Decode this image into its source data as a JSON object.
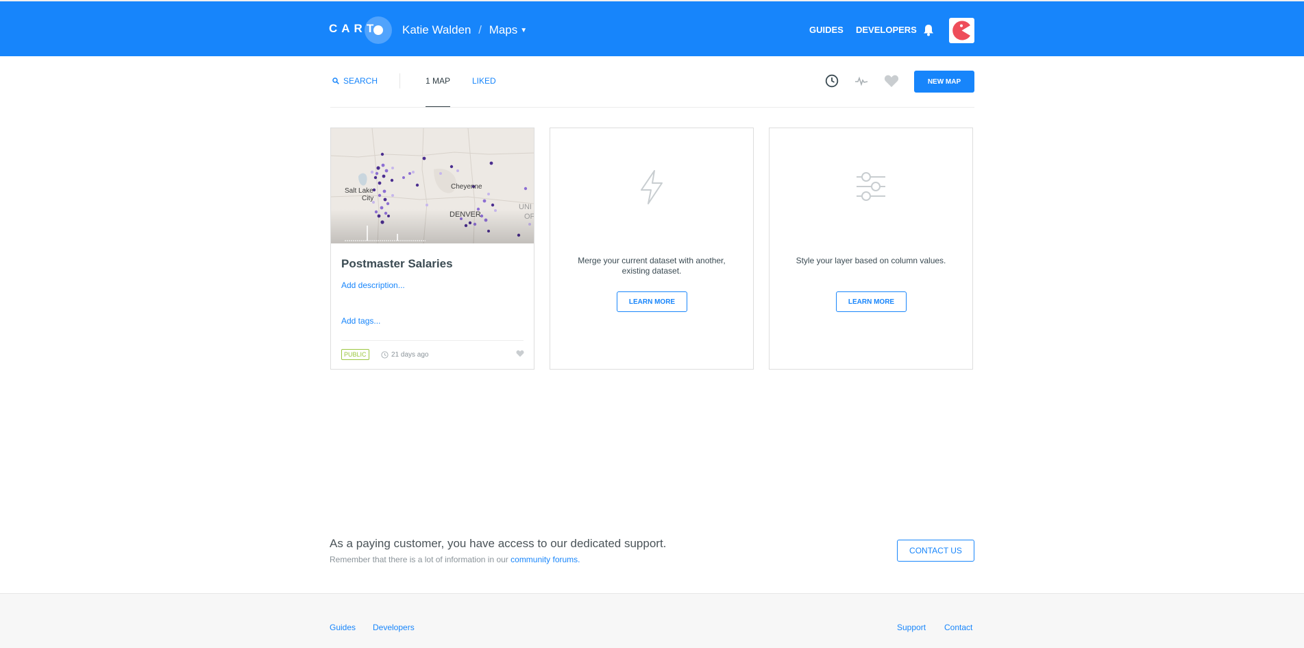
{
  "header": {
    "logo_text": "CART",
    "user_name": "Katie Walden",
    "separator": "/",
    "section": "Maps",
    "nav": {
      "guides": "GUIDES",
      "developers": "DEVELOPERS"
    },
    "brand_color": "#1785fb"
  },
  "toolbar": {
    "search_label": "SEARCH",
    "tabs": [
      {
        "label": "1 MAP",
        "active": true
      },
      {
        "label": "LIKED",
        "active": false
      }
    ],
    "sort_icons": [
      "clock-icon",
      "activity-icon",
      "heart-icon"
    ],
    "new_map_label": "NEW MAP"
  },
  "cards": {
    "map": {
      "title": "Postmaster Salaries",
      "description_placeholder": "Add description...",
      "tags_placeholder": "Add tags...",
      "privacy": "PUBLIC",
      "updated": "21 days ago",
      "map_labels": {
        "city1": "Salt Lake",
        "city1b": "City",
        "city2": "Cheyenne",
        "city3": "DENVER",
        "edge1": "UNI",
        "edge2": "OF"
      }
    },
    "merge": {
      "icon": "lightning-icon",
      "text": "Merge your current dataset with another, existing dataset.",
      "button": "LEARN MORE"
    },
    "style": {
      "icon": "sliders-icon",
      "text": "Style your layer based on column values.",
      "button": "LEARN MORE"
    }
  },
  "support": {
    "title": "As a paying customer, you have access to our dedicated support.",
    "subtitle_prefix": "Remember that there is a lot of information in our",
    "subtitle_link": "community forums.",
    "contact_button": "CONTACT US"
  },
  "footer": {
    "left_links": [
      "Guides",
      "Developers"
    ],
    "right_links": [
      "Support",
      "Contact"
    ]
  }
}
